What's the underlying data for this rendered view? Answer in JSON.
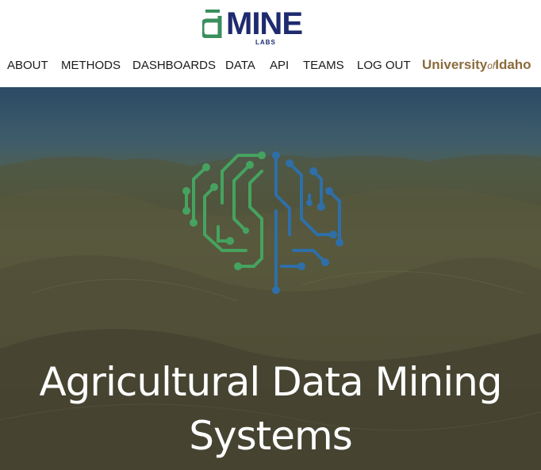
{
  "brand": {
    "logo_main": "MINE",
    "logo_sub": "LABS",
    "logo_colors": {
      "accent": "#3a8f5c",
      "primary": "#1e2b6e"
    }
  },
  "nav": {
    "items": [
      {
        "label": "ABOUT"
      },
      {
        "label": "METHODS"
      },
      {
        "label": "DASHBOARDS"
      },
      {
        "label": "DATA"
      },
      {
        "label": "API"
      },
      {
        "label": "TEAMS"
      },
      {
        "label": "LOG OUT"
      }
    ]
  },
  "university": {
    "name_part1": "University",
    "name_of": "of",
    "name_part2": "Idaho",
    "color": "#8b6b3c"
  },
  "hero": {
    "title_line1": "Agricultural Data Mining",
    "title_line2": "Systems",
    "icon": "circuit-brain-icon",
    "icon_colors": {
      "left": "#45a35f",
      "right": "#2e6fa8"
    }
  }
}
